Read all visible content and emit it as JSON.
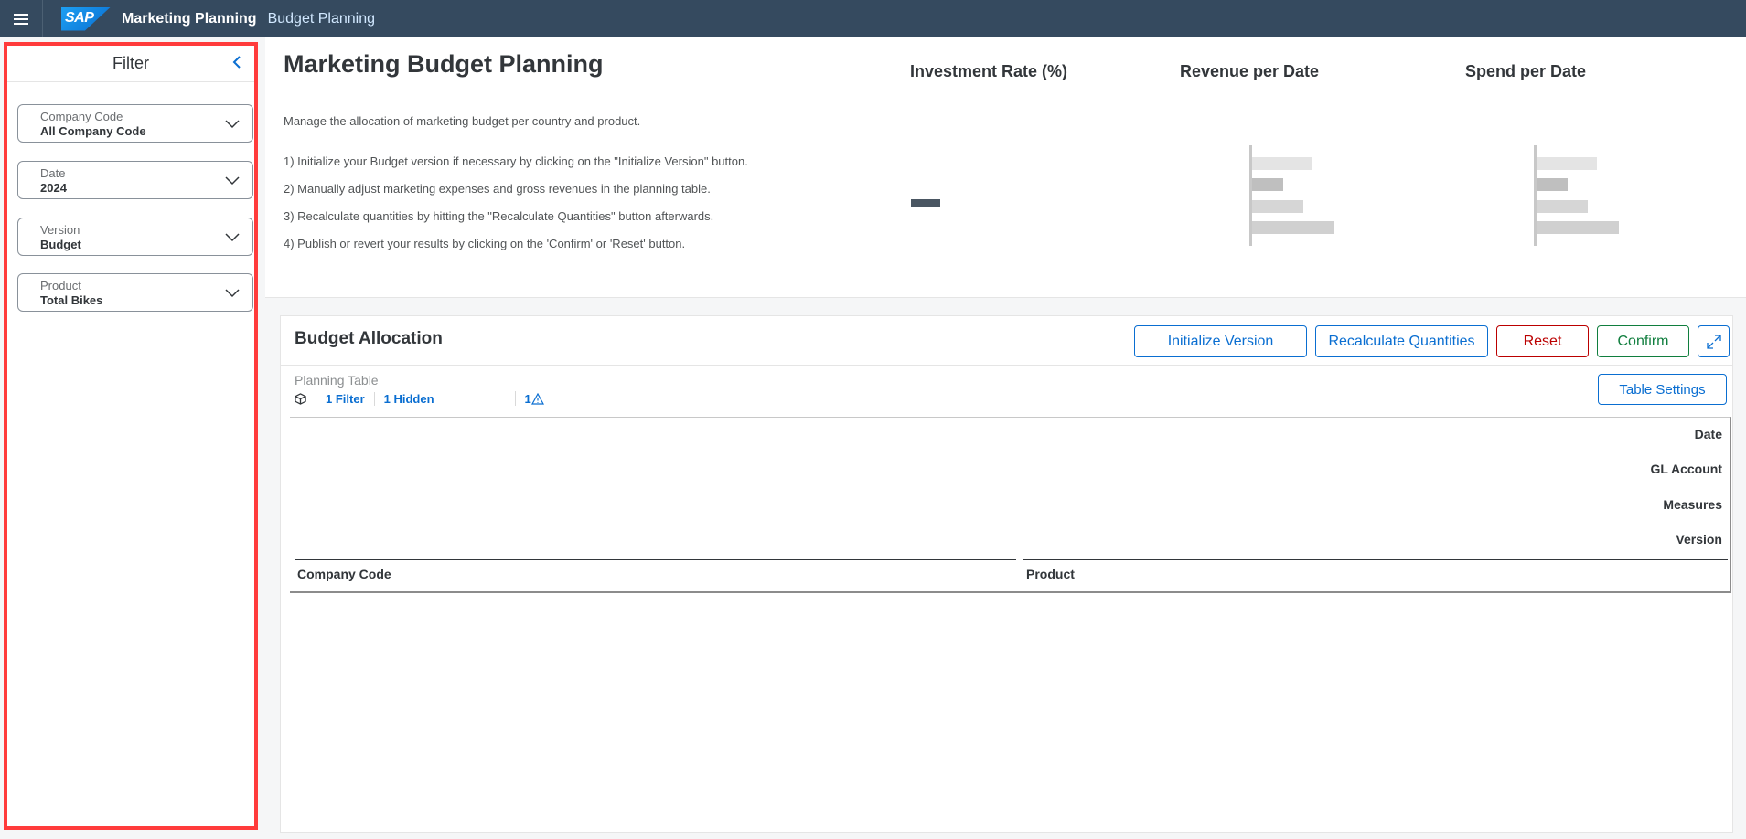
{
  "shell": {
    "menu_icon": "hamburger-menu-icon",
    "logo_text": "SAP",
    "app_title": "Marketing Planning",
    "sub_title": "Budget Planning"
  },
  "filter": {
    "title": "Filter",
    "collapse_icon": "chevron-left-icon",
    "fields": [
      {
        "label": "Company Code",
        "value": "All Company Code"
      },
      {
        "label": "Date",
        "value": "2024"
      },
      {
        "label": "Version",
        "value": "Budget"
      },
      {
        "label": "Product",
        "value": "Total Bikes"
      }
    ]
  },
  "header": {
    "title": "Marketing Budget Planning",
    "intro": "Manage the allocation of marketing budget per country and product.",
    "steps": [
      "1) Initialize your Budget version if necessary by clicking on the \"Initialize Version\" button.",
      "2) Manually adjust marketing expenses and gross revenues in the planning table.",
      "3) Recalculate quantities by hitting the \"Recalculate Quantities\" button afterwards.",
      "4) Publish or revert your results by clicking on the 'Confirm' or 'Reset' button."
    ],
    "kpis": [
      {
        "title": "Investment Rate (%)"
      },
      {
        "title": "Revenue per Date"
      },
      {
        "title": "Spend per Date"
      }
    ]
  },
  "allocation": {
    "title": "Budget Allocation",
    "buttons": {
      "initialize": "Initialize Version",
      "recalculate": "Recalculate Quantities",
      "reset": "Reset",
      "confirm": "Confirm",
      "fullscreen_icon": "expand-icon"
    },
    "table_caption": "Planning Table",
    "toolbar": {
      "cube_icon": "cube-icon",
      "filter_link": "1 Filter",
      "hidden_link": "1 Hidden",
      "warning_count": "1",
      "warning_icon": "warning-icon"
    },
    "table_settings": "Table Settings",
    "row_dimensions": [
      "Date",
      "GL Account",
      "Measures",
      "Version"
    ],
    "column_headers": [
      "Company Code",
      "Product"
    ]
  },
  "colors": {
    "shell_bg": "#354a5f",
    "accent_blue": "#0a6ed1",
    "reset_red": "#bb0000",
    "confirm_green": "#107e3e",
    "highlight_border": "#ff3b3b"
  }
}
